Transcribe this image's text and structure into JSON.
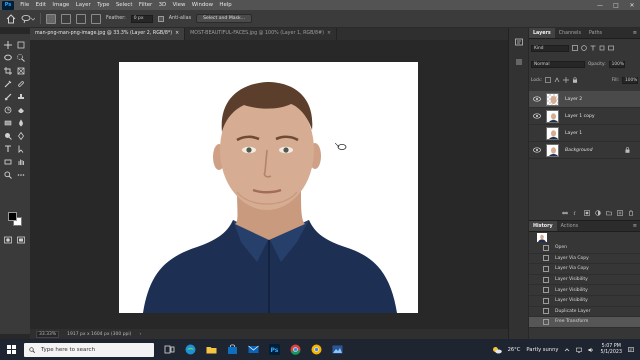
{
  "app": {
    "logo": "Ps",
    "menu": [
      "File",
      "Edit",
      "Image",
      "Layer",
      "Type",
      "Select",
      "Filter",
      "3D",
      "View",
      "Window",
      "Help"
    ],
    "window_controls": [
      "—",
      "□",
      "✕"
    ]
  },
  "options_bar": {
    "feather_label": "Feather:",
    "feather_value": "0 px",
    "antialias_label": "Anti-alias",
    "select_mask_label": "Select and Mask..."
  },
  "tabs": [
    {
      "label": "man-png-man-png-image.jpg @ 33.3% (Layer 2, RGB/8*)",
      "close": "×",
      "active": true
    },
    {
      "label": "MOST-BEAUTIFUL-FACES.jpg @ 100% (Layer 1, RGB/8#)",
      "close": "×",
      "active": false
    }
  ],
  "status_bar": {
    "zoom": "33.33%",
    "doc_info": "1917 px x 1604 px (300 ppi)",
    "arrow": "›"
  },
  "layers_panel": {
    "tabs": [
      "Layers",
      "Channels",
      "Paths"
    ],
    "menu_glyph": "≡",
    "kind_filter": "Kind",
    "blend_mode": "Normal",
    "opacity_label": "Opacity:",
    "opacity_value": "100%",
    "lock_label": "Lock:",
    "fill_label": "Fill:",
    "fill_value": "100%",
    "layers": [
      {
        "name": "Layer 2",
        "visible": true,
        "selected": true,
        "italic": false,
        "locked": false
      },
      {
        "name": "Layer 1 copy",
        "visible": true,
        "selected": false,
        "italic": false,
        "locked": false
      },
      {
        "name": "Layer 1",
        "visible": false,
        "selected": false,
        "italic": false,
        "locked": false
      },
      {
        "name": "Background",
        "visible": true,
        "selected": false,
        "italic": true,
        "locked": true
      }
    ]
  },
  "history_panel": {
    "tabs": [
      "History",
      "Actions"
    ],
    "items": [
      {
        "label": "Open",
        "current": false
      },
      {
        "label": "Layer Via Copy",
        "current": false
      },
      {
        "label": "Layer Via Copy",
        "current": false
      },
      {
        "label": "Layer Visibility",
        "current": false
      },
      {
        "label": "Layer Visibility",
        "current": false
      },
      {
        "label": "Layer Visibility",
        "current": false
      },
      {
        "label": "Duplicate Layer",
        "current": false
      },
      {
        "label": "Free Transform",
        "current": true
      }
    ]
  },
  "taskbar": {
    "search_placeholder": "Type here to search",
    "weather_temp": "26°C",
    "weather_desc": "Partly sunny",
    "time": "5:07 PM",
    "date": "5/1/2023"
  },
  "colors": {
    "accent": "#31a8ff",
    "shirt": "#1d2f52",
    "skin": "#d6ad92"
  }
}
